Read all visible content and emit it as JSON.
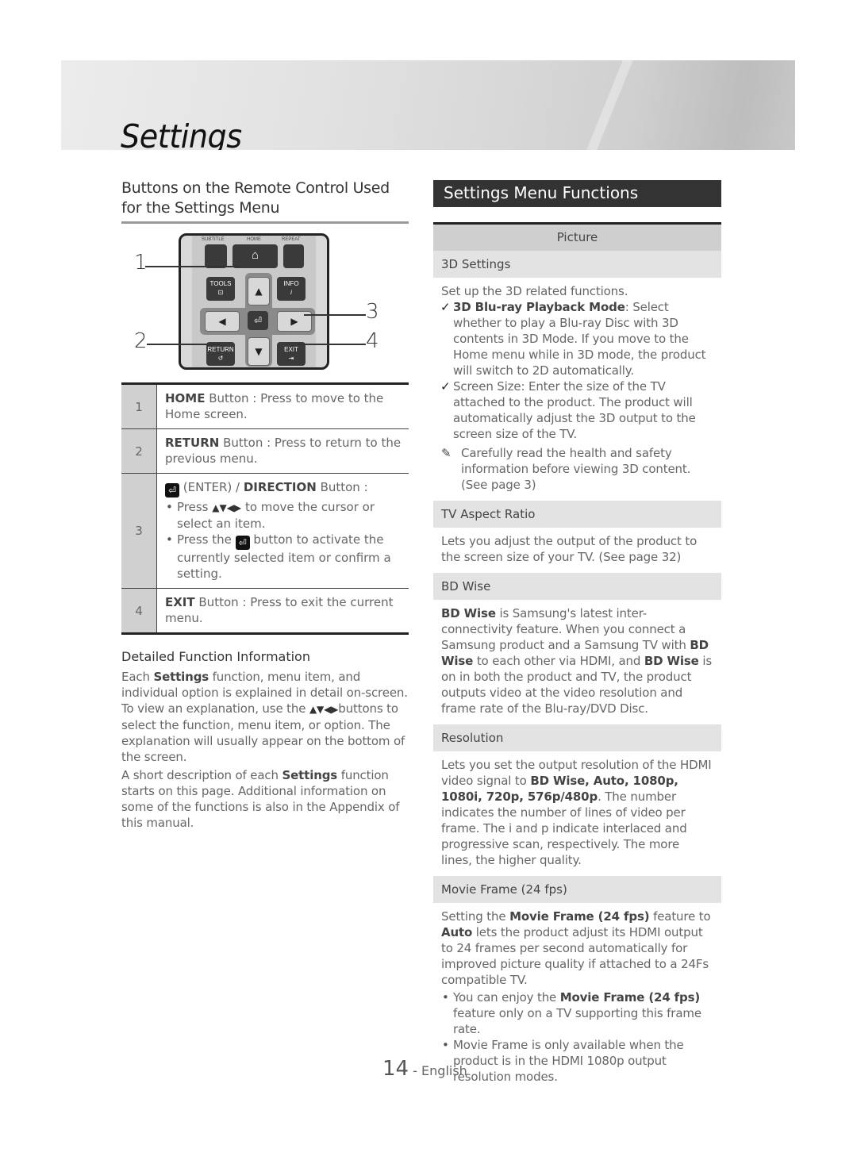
{
  "banner": {
    "title": "Settings"
  },
  "left": {
    "section_title": "Buttons on the Remote Control Used for the Settings Menu",
    "remote": {
      "labels": {
        "subtitle": "SUBTITLE",
        "home": "HOME",
        "repeat": "REPEAT",
        "tools": "TOOLS",
        "info": "INFO",
        "return": "RETURN",
        "exit": "EXIT"
      },
      "icons": {
        "home": "⌂",
        "info": "i",
        "tools": "⊡",
        "return": "↺",
        "exit": "⇥",
        "enter": "⏎",
        "up": "▲",
        "down": "▼",
        "left": "◀",
        "right": "▶"
      },
      "callouts": [
        "1",
        "2",
        "3",
        "4"
      ]
    },
    "table": [
      {
        "num": "1",
        "key": "HOME",
        "text": " Button : Press to move to the Home screen."
      },
      {
        "num": "2",
        "key": "RETURN",
        "text": " Button : Press to return to the previous menu."
      },
      {
        "num": "3",
        "enter_icon": "⏎",
        "key_pre": " (ENTER) / ",
        "key": "DIRECTION",
        "text": " Button :",
        "bullets": [
          {
            "pre": "Press ",
            "arrows": "▲▼◀▶",
            "post": " to move the cursor or select an item."
          },
          {
            "pre": "Press the ",
            "icon": "⏎",
            "post": " button to activate the currently selected item or confirm a setting."
          }
        ]
      },
      {
        "num": "4",
        "key": "EXIT",
        "text": " Button : Press to exit the current menu."
      }
    ],
    "detail_title": "Detailed Function Information",
    "para1": {
      "a": "Each ",
      "b": "Settings",
      "c": " function, menu item, and individual option is explained in detail on-screen. To view an explanation, use the ",
      "arrows": "▲▼◀▶",
      "d": "buttons to select the function, menu item, or option. The explanation will usually appear on the bottom of the screen."
    },
    "para2": {
      "a": "A short description of each ",
      "b": "Settings",
      "c": " function starts on this page. Additional information on some of the functions is also in the Appendix of this manual."
    }
  },
  "right": {
    "section_title": "Settings Menu Functions",
    "category": "Picture",
    "items": {
      "settings_3d": {
        "title": "3D Settings",
        "intro": "Set up the 3D related functions.",
        "check1": {
          "b": "3D Blu-ray Playback Mode",
          "t": ": Select whether to play a Blu-ray Disc with 3D contents in 3D Mode. If you move to the Home menu while in 3D mode, the product will switch to 2D automatically."
        },
        "check2": "Screen Size: Enter the size of the TV attached to the product. The product will automatically adjust the 3D output to the screen size of the TV.",
        "note_icon": "✎",
        "note": "Carefully read the health and safety information before viewing 3D content. (See page 3)"
      },
      "aspect": {
        "title": "TV Aspect Ratio",
        "body": "Lets you adjust the output of the product to the screen size of your TV. (See page 32)"
      },
      "bdwise": {
        "title": "BD Wise",
        "b1": "BD Wise",
        "t1": " is Samsung's latest inter-connectivity feature. When you connect a Samsung product and a Samsung TV with ",
        "b2": "BD Wise",
        "t2": " to each other via HDMI, and ",
        "b3": "BD Wise",
        "t3": " is on in both the product and TV, the product outputs video at the video resolution and frame rate of the Blu-ray/DVD Disc."
      },
      "resolution": {
        "title": "Resolution",
        "t1": "Lets you set the output resolution of the HDMI video signal to ",
        "b1": "BD Wise, Auto, 1080p, 1080i, 720p, 576p/480p",
        "t2": ". The number indicates the number of lines of video per frame. The i and p indicate interlaced and progressive scan, respectively. The more lines, the higher quality."
      },
      "movie": {
        "title": "Movie Frame (24 fps)",
        "t1": "Setting the ",
        "b1": "Movie Frame (24 fps)",
        "t2": " feature to ",
        "b2": "Auto",
        "t3": " lets the product adjust its HDMI output to 24 frames per second automatically for improved picture quality if attached to a 24Fs compatible TV.",
        "bullet1": {
          "a": "You can enjoy the ",
          "b": "Movie Frame (24 fps)",
          "c": " feature only on a TV supporting this frame rate."
        },
        "bullet2": "Movie Frame is only available when the product is in the HDMI 1080p output resolution modes."
      }
    }
  },
  "footer": {
    "page": "14",
    "sep": " - ",
    "lang": "English"
  }
}
